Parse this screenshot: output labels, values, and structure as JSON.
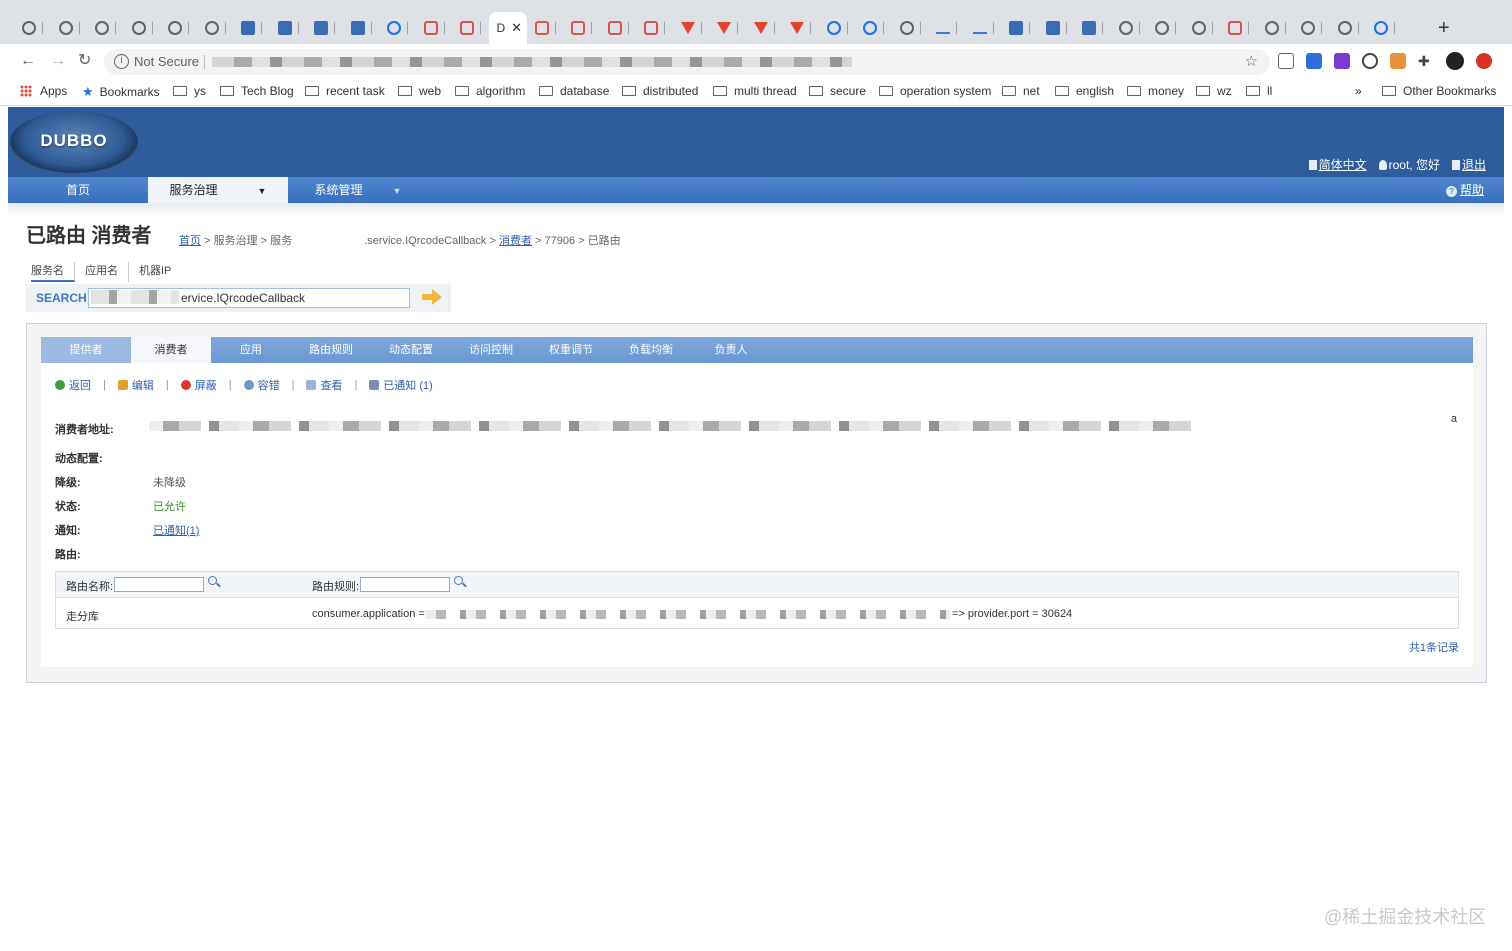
{
  "browser": {
    "active_tab_label": "D",
    "address": {
      "security_text": "Not Secure"
    },
    "bookmarks": [
      {
        "label": "Apps",
        "type": "apps"
      },
      {
        "label": "Bookmarks",
        "type": "star"
      },
      {
        "label": "ys",
        "type": "folder"
      },
      {
        "label": "Tech Blog",
        "type": "folder"
      },
      {
        "label": "recent task",
        "type": "folder"
      },
      {
        "label": "web",
        "type": "folder"
      },
      {
        "label": "algorithm",
        "type": "folder"
      },
      {
        "label": "database",
        "type": "folder"
      },
      {
        "label": "distributed",
        "type": "folder"
      },
      {
        "label": "multi thread",
        "type": "folder"
      },
      {
        "label": "secure",
        "type": "folder"
      },
      {
        "label": "operation system",
        "type": "folder"
      },
      {
        "label": "net",
        "type": "folder"
      },
      {
        "label": "english",
        "type": "folder"
      },
      {
        "label": "money",
        "type": "folder"
      },
      {
        "label": "wz",
        "type": "folder"
      },
      {
        "label": "ll",
        "type": "folder"
      }
    ],
    "bookmarks_overflow": "»",
    "other_bookmarks": "Other Bookmarks"
  },
  "header": {
    "logo_text": "DUBBO",
    "lang_link": "简体中文",
    "user_text": "root, 您好",
    "logout_link": "退出"
  },
  "menu": {
    "items": [
      "首页",
      "服务治理",
      "系统管理"
    ],
    "help": "帮助"
  },
  "page": {
    "title": "已路由 消费者",
    "breadcrumb": {
      "home": "首页",
      "sep": ">",
      "gov": "服务治理",
      "service": "服务",
      "service_name": ".service.IQrcodeCallback",
      "consumer": "消费者",
      "id": "77906",
      "current": "已路由"
    }
  },
  "search": {
    "tabs": [
      "服务名",
      "应用名",
      "机器IP"
    ],
    "label": "SEARCH",
    "value": "ervice.IQrcodeCallback"
  },
  "panel": {
    "tabs": [
      "提供者",
      "消费者",
      "应用",
      "路由规则",
      "动态配置",
      "访问控制",
      "权重调节",
      "负载均衡",
      "负责人"
    ],
    "actions": [
      "返回",
      "编辑",
      "屏蔽",
      "容错",
      "查看",
      "已通知 (1)"
    ],
    "fields": {
      "consumer_address_label": "消费者地址:",
      "consumer_address_tail": "a",
      "dynamic_config_label": "动态配置:",
      "degrade_label": "降级:",
      "degrade_value": "未降级",
      "status_label": "状态:",
      "status_value": "已允许",
      "notify_label": "通知:",
      "notify_value": "已通知(1)",
      "route_label": "路由:"
    },
    "route_table": {
      "filter_name_label": "路由名称:",
      "filter_rule_label": "路由规则:",
      "row": {
        "name": "走分库",
        "rule_prefix": "consumer.application =",
        "rule_suffix": "=> provider.port = 30624"
      }
    },
    "record_count": "共1条记录"
  },
  "watermark": "@稀土掘金技术社区"
}
